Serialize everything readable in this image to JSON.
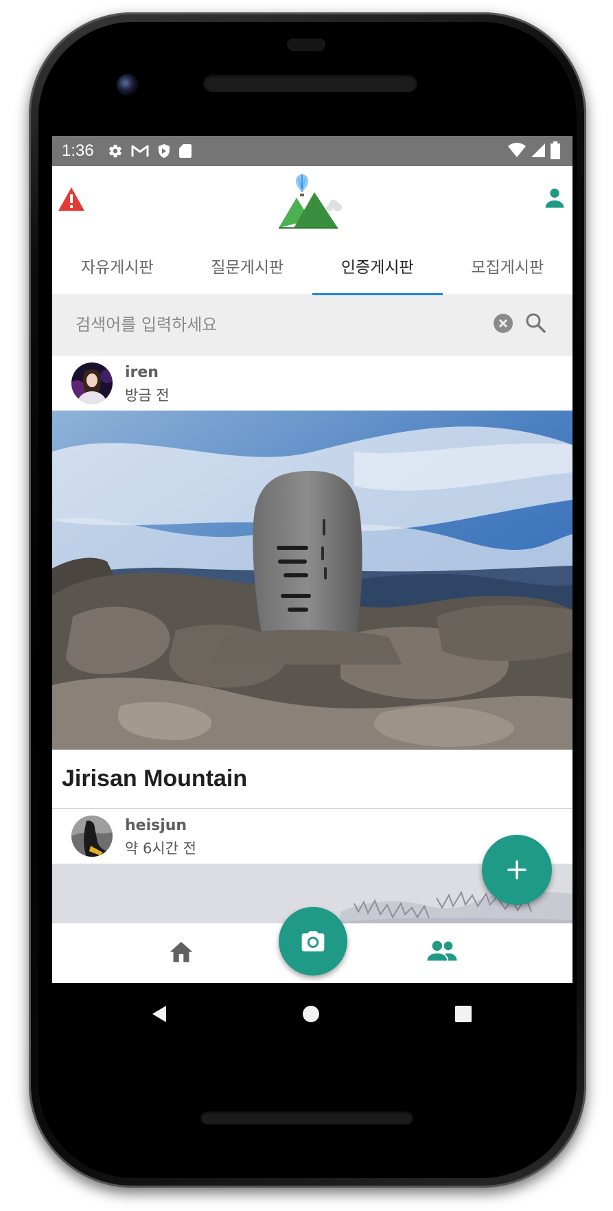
{
  "status_bar": {
    "time": "1:36",
    "left_icons": [
      "settings-icon",
      "gmail-icon",
      "shield-icon",
      "sd-card-icon"
    ],
    "right_icons": [
      "wifi-icon",
      "signal-icon",
      "battery-icon"
    ]
  },
  "app_bar": {
    "left_icon": "warning-icon",
    "logo": "mountain-logo",
    "right_icon": "profile-icon"
  },
  "tabs": [
    {
      "label": "자유게시판",
      "active": false
    },
    {
      "label": "질문게시판",
      "active": false
    },
    {
      "label": "인증게시판",
      "active": true
    },
    {
      "label": "모집게시판",
      "active": false
    }
  ],
  "search": {
    "placeholder": "검색어를 입력하세요"
  },
  "posts": [
    {
      "username": "iren",
      "time_ago": "방금 전",
      "title": "Jirisan Mountain"
    },
    {
      "username": "heisjun",
      "time_ago": "약 6시간 전"
    }
  ],
  "bottom_nav": {
    "items": [
      "home-icon",
      "camera-icon",
      "people-icon"
    ],
    "active": "people-icon"
  },
  "colors": {
    "accent": "#1e9a86",
    "tab_indicator": "#1e88e5",
    "warning": "#e53935",
    "status_bar": "#757575"
  }
}
